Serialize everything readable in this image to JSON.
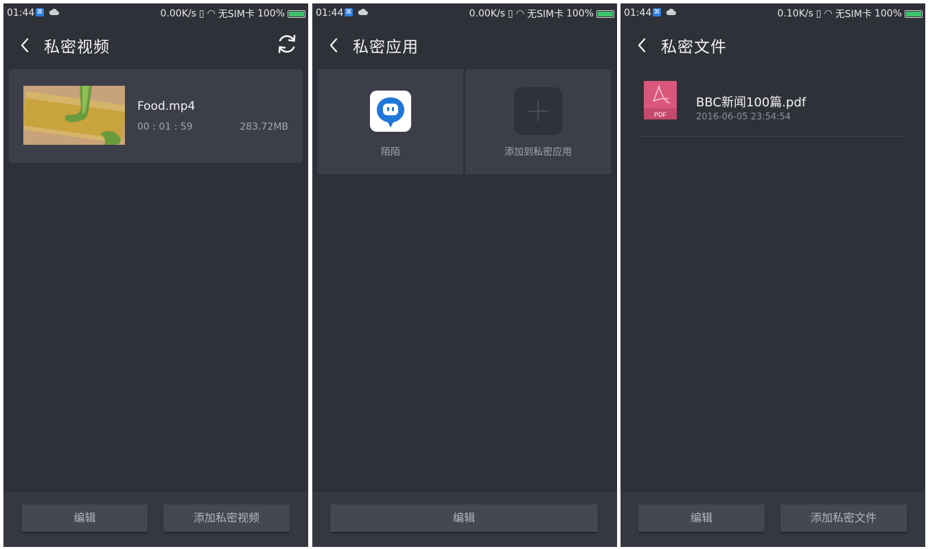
{
  "screens": [
    {
      "status": {
        "time": "01:44",
        "speed": "0.00K/s",
        "sim": "无SIM卡",
        "battery": "100%"
      },
      "title": "私密视频",
      "video": {
        "name": "Food.mp4",
        "duration": "00 : 01 : 59",
        "size": "283.72MB"
      },
      "buttons": {
        "edit": "编辑",
        "add": "添加私密视频"
      }
    },
    {
      "status": {
        "time": "01:44",
        "speed": "0.00K/s",
        "sim": "无SIM卡",
        "battery": "100%"
      },
      "title": "私密应用",
      "apps": [
        {
          "label": "陌陌",
          "icon": "momo-app-icon"
        },
        {
          "label": "添加到私密应用",
          "icon": "plus-icon"
        }
      ],
      "buttons": {
        "edit": "编辑"
      }
    },
    {
      "status": {
        "time": "01:44",
        "speed": "0.10K/s",
        "sim": "无SIM卡",
        "battery": "100%"
      },
      "title": "私密文件",
      "file": {
        "name": "BBC新闻100篇.pdf",
        "date": "2016-06-05 23:54:54",
        "type_label": "PDF"
      },
      "buttons": {
        "edit": "编辑",
        "add": "添加私密文件"
      }
    }
  ],
  "colors": {
    "background": "#2f3139",
    "card": "#3c3e49",
    "accent_blue": "#1f78d8",
    "pdf_pink": "#d9577b",
    "battery_green": "#3ec26b"
  }
}
